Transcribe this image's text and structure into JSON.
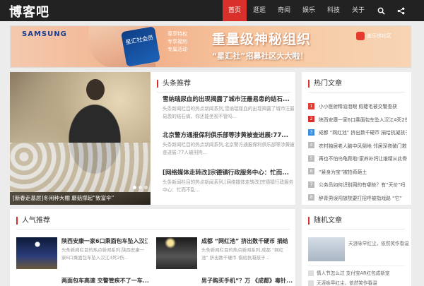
{
  "site": {
    "logo": "博客吧"
  },
  "nav": {
    "items": [
      "首页",
      "逛逛",
      "奇闻",
      "娱乐",
      "科技",
      "关于"
    ],
    "active_index": 0,
    "icons": [
      "search-icon",
      "share-icon"
    ]
  },
  "banner": {
    "brand": "SAMSUNG",
    "card_text": "星汇社会员",
    "sub_text_1": "尊享特权",
    "sub_text_2": "专享福利",
    "sub_text_3": "专属活动",
    "headline": "重量级神秘组织",
    "subline": "“星汇社”招募社区大大啦！",
    "community": "盖乐世社区"
  },
  "featured": {
    "caption": "[新春走基层]冬闲种大棚 蘑菇撑起“致富伞”",
    "slide_count": 3,
    "active_slide": 0
  },
  "headline_section": {
    "title": "头条推荐",
    "items": [
      {
        "title": "雪纳瑞尿血的出现揭露了城市汪最易患的结石...",
        "desc": "头条新闻栏目的热点新闻系列,雪纳瑞尿血的出现揭露了城市汪最易患的结石病，你还能坐视不管吗..."
      },
      {
        "title": "北京警方通报保利俱乐部等涉黄被查进展:77...",
        "desc": "头条新闻栏目的热点新闻系列,北京警方通报保利俱乐部等涉黄被查进展:77人被刑拘..."
      },
      {
        "title": "[网络媒体走转改]宗德镇行政服务中心：忙而...",
        "desc": "头条新闻栏目的热点新闻系列,[网络媒体走转改]宗德镇行政服务中心：忙而不乱..."
      }
    ]
  },
  "hot_section": {
    "title": "热门文章",
    "items": [
      {
        "rank": "1",
        "text": "小小医射精油泡眼 假睫毛被交警查获"
      },
      {
        "rank": "2",
        "text": "陕西安康一家6口乘面包车坠入汉江4死2伤"
      },
      {
        "rank": "3",
        "text": "成都 “网红池” 挤出数千硬币 捐给抗凝孩子"
      },
      {
        "rank": "4",
        "text": "农村独居老人脑中风倒地 邻居深夜破门救人"
      },
      {
        "rank": "5",
        "text": "再也不怕乌龟爬啦!家养补钙让维精从此骨头"
      },
      {
        "rank": "6",
        "text": "“紧身为宝”被拍奇葩土"
      },
      {
        "rank": "7",
        "text": "公务员如何识别网的有哪些？有“天价”吗"
      },
      {
        "rank": "8",
        "text": "醉青男误闯旅院要打招呼被指戏路 “它”"
      }
    ]
  },
  "popular_section": {
    "title": "人气推荐",
    "items": [
      {
        "title": "陕西安康一家6口乘面包车坠入汉江...",
        "desc": "头条新闻栏目的热点新闻系列,陕西安康一家6口乘面包车坠入汉江4死2伤..."
      },
      {
        "title": "成都 “网红池” 挤出数千硬币 捐给...",
        "desc": "头条新闻栏目的热点新闻系列,成都 “网红池” 挤出数千硬币 捐给抗凝孩子..."
      }
    ],
    "more_titles": [
      "两面包车高速 交警管疾不了一车...",
      "男子购买手机“？万 《成都》毒针..."
    ]
  },
  "random_section": {
    "title": "随机文章",
    "items": [
      {
        "text": "天涯咏早红尘，依然笑作春温"
      },
      {
        "text": "情人节怎么过 支付宝AR红包成新宠"
      },
      {
        "text": "天涯咏早红尘，依然笑作春温"
      }
    ]
  }
}
